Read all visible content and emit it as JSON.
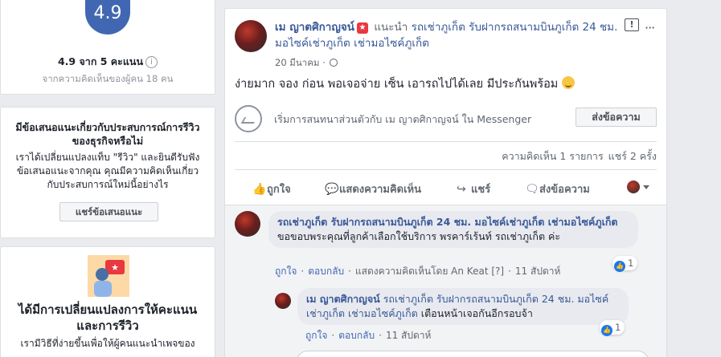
{
  "rating": {
    "score": "4.9",
    "summary": "4.9 จาก 5 คะแนน",
    "info_icon": "i",
    "subtext": "จากความคิดเห็นของผู้คน 18 คน"
  },
  "suggest": {
    "title": "มีข้อเสนอแนะเกี่ยวกับประสบการณ์การรีวิวของธุรกิจหรือไม่",
    "body": "เราได้เปลี่ยนแปลงแท็บ \"รีวิว\" และยินดีรับฟังข้อเสนอแนะจากคุณ คุณมีความคิดเห็นเกี่ยวกับประสบการณ์ใหม่นี้อย่างไร",
    "button": "แชร์ข้อเสนอแนะ"
  },
  "change": {
    "title": "ได้มีการเปลี่ยนแปลงการให้คะแนนและการรีวิว",
    "body": "เรามีวิธีที่ง่ายขึ้นเพื่อให้ผู้คนแนะนำเพจของ"
  },
  "post": {
    "author": "เม ญาตศิกาญจน์",
    "badge": "★",
    "verb": "แนะนำ",
    "page_name": "รถเช่าภูเก็ต รับฝากรถสนามบินภูเก็ต 24 ชม. มอไซค์เช่าภูเก็ต เช่ามอไซค์ภูเก็ต",
    "date": "20 มีนาคม",
    "feedback_icon": "!",
    "more_icon": "···",
    "text": "ง่ายมาก จอง ก่อน พอเจอจ่าย เซ็น เอารถไปได้เลย มีประกันพร้อม",
    "messenger_prompt": "เริ่มการสนทนาส่วนตัวกับ เม ญาตศิกาญจน์ ใน Messenger",
    "send_message_button": "ส่งข้อความ",
    "comments_count": "ความคิดเห็น 1 รายการ",
    "shares_count": "แชร์ 2 ครั้ง",
    "actions": {
      "like": "ถูกใจ",
      "comment": "แสดงความคิดเห็น",
      "share": "แชร์",
      "message": "ส่งข้อความ"
    }
  },
  "comments": [
    {
      "name": "รถเช่าภูเก็ต รับฝากรถสนามบินภูเก็ต 24 ชม. มอไซค์เช่าภูเก็ต เช่ามอไซค์ภูเก็ต",
      "text": "ขอขอบพระคุณที่ลูกค้าเลือกใช้บริการ พรคาร์เร้นท์ รถเช่าภูเก็ต ค่ะ",
      "like": "ถูกใจ",
      "reply": "ตอบกลับ",
      "by_line": "แสดงความคิดเห็นโดย An Keat",
      "by_mark": "[?]",
      "time": "11 สัปดาห์",
      "likes": "1"
    },
    {
      "name": "เม ญาตศิกาญจน์",
      "mention": "รถเช่าภูเก็ต รับฝากรถสนามบินภูเก็ต 24 ชม. มอไซค์เช่าภูเก็ต เช่ามอไซค์ภูเก็ต",
      "text": "เตือนหน้าเจอกันอีกรอบจ้า",
      "like": "ถูกใจ",
      "reply": "ตอบกลับ",
      "time": "11 สัปดาห์",
      "likes": "1"
    }
  ],
  "colors": {
    "accent": "#4267b2",
    "link": "#385898",
    "background": "#e9ebee"
  }
}
